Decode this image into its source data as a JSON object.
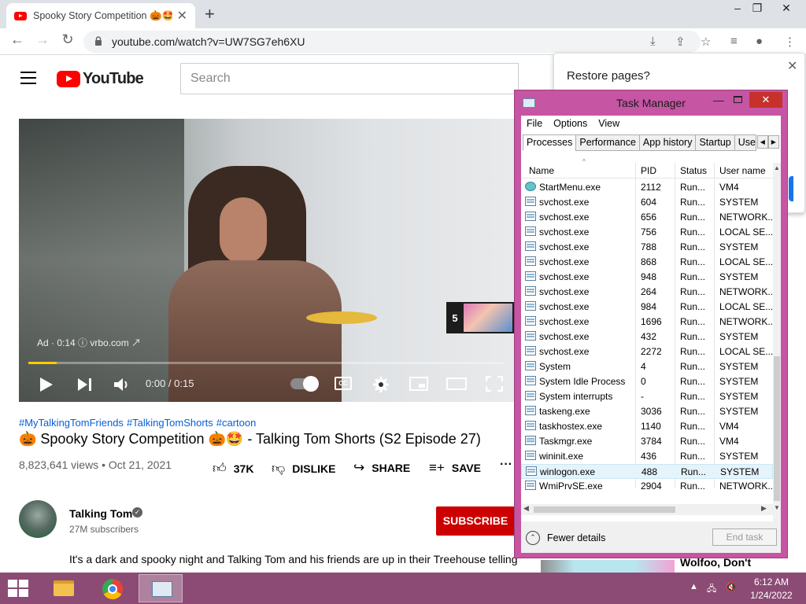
{
  "browser": {
    "tab_title": "Spooky Story Competition 🎃🤩",
    "url": "youtube.com/watch?v=UW7SG7eh6XU"
  },
  "youtube": {
    "logo_text": "YouTube",
    "search_placeholder": "Search",
    "player": {
      "ad_label": "Ad · 0:14 ⓘ  vrbo.com ↗",
      "next_ad_count": "5",
      "time": "0:00 / 0:15",
      "progress_fraction": 0.06,
      "cc_label": "CC"
    },
    "hashtags": [
      "#MyTalkingTomFriends",
      "#TalkingTomShorts",
      "#cartoon"
    ],
    "title": "🎃 Spooky Story Competition 🎃🤩 - Talking Tom Shorts (S2 Episode 27)",
    "views": "8,823,641 views • Oct 21, 2021",
    "actions": {
      "like": "37K",
      "dislike": "DISLIKE",
      "share": "SHARE",
      "save": "SAVE"
    },
    "channel": {
      "name": "Talking Tom",
      "subscribers": "27M subscribers",
      "subscribe_label": "SUBSCRIBE"
    },
    "description": "It's a dark and spooky night and Talking Tom and his friends are up in their Treehouse telling scary stories by torchlight... But who's going to tell the SCARIEST story?! And when poison...",
    "recommended_title": "Wolfoo, Don't"
  },
  "restore_popup": {
    "title": "Restore pages?"
  },
  "task_manager": {
    "title": "Task Manager",
    "menu": [
      "File",
      "Options",
      "View"
    ],
    "tabs": [
      "Processes",
      "Performance",
      "App history",
      "Startup",
      "User"
    ],
    "columns": {
      "name": "Name",
      "pid": "PID",
      "status": "Status",
      "user": "User name"
    },
    "rows": [
      {
        "name": "StartMenu.exe",
        "pid": "2112",
        "status": "Run...",
        "user": "VM4",
        "icon": "startmenu-icon"
      },
      {
        "name": "svchost.exe",
        "pid": "604",
        "status": "Run...",
        "user": "SYSTEM",
        "icon": "process-icon"
      },
      {
        "name": "svchost.exe",
        "pid": "656",
        "status": "Run...",
        "user": "NETWORK...",
        "icon": "process-icon"
      },
      {
        "name": "svchost.exe",
        "pid": "756",
        "status": "Run...",
        "user": "LOCAL SE...",
        "icon": "process-icon"
      },
      {
        "name": "svchost.exe",
        "pid": "788",
        "status": "Run...",
        "user": "SYSTEM",
        "icon": "process-icon"
      },
      {
        "name": "svchost.exe",
        "pid": "868",
        "status": "Run...",
        "user": "LOCAL SE...",
        "icon": "process-icon"
      },
      {
        "name": "svchost.exe",
        "pid": "948",
        "status": "Run...",
        "user": "SYSTEM",
        "icon": "process-icon"
      },
      {
        "name": "svchost.exe",
        "pid": "264",
        "status": "Run...",
        "user": "NETWORK...",
        "icon": "process-icon"
      },
      {
        "name": "svchost.exe",
        "pid": "984",
        "status": "Run...",
        "user": "LOCAL SE...",
        "icon": "process-icon"
      },
      {
        "name": "svchost.exe",
        "pid": "1696",
        "status": "Run...",
        "user": "NETWORK...",
        "icon": "process-icon"
      },
      {
        "name": "svchost.exe",
        "pid": "432",
        "status": "Run...",
        "user": "SYSTEM",
        "icon": "process-icon"
      },
      {
        "name": "svchost.exe",
        "pid": "2272",
        "status": "Run...",
        "user": "LOCAL SE...",
        "icon": "process-icon"
      },
      {
        "name": "System",
        "pid": "4",
        "status": "Run...",
        "user": "SYSTEM",
        "icon": "process-icon"
      },
      {
        "name": "System Idle Process",
        "pid": "0",
        "status": "Run...",
        "user": "SYSTEM",
        "icon": "process-icon"
      },
      {
        "name": "System interrupts",
        "pid": "-",
        "status": "Run...",
        "user": "SYSTEM",
        "icon": "process-icon"
      },
      {
        "name": "taskeng.exe",
        "pid": "3036",
        "status": "Run...",
        "user": "SYSTEM",
        "icon": "process-icon"
      },
      {
        "name": "taskhostex.exe",
        "pid": "1140",
        "status": "Run...",
        "user": "VM4",
        "icon": "process-icon"
      },
      {
        "name": "Taskmgr.exe",
        "pid": "3784",
        "status": "Run...",
        "user": "VM4",
        "icon": "taskmgr-icon"
      },
      {
        "name": "wininit.exe",
        "pid": "436",
        "status": "Run...",
        "user": "SYSTEM",
        "icon": "process-icon"
      },
      {
        "name": "winlogon.exe",
        "pid": "488",
        "status": "Run...",
        "user": "SYSTEM",
        "icon": "process-icon",
        "selected": true
      },
      {
        "name": "WmiPrvSE.exe",
        "pid": "2904",
        "status": "Run...",
        "user": "NETWORK...",
        "icon": "process-icon"
      }
    ],
    "fewer_details": "Fewer details",
    "end_task": "End task"
  },
  "taskbar": {
    "time": "6:12 AM",
    "date": "1/24/2022"
  },
  "colors": {
    "task_manager_frame": "#c655a3",
    "taskbar": "#8c4b75",
    "subscribe_button": "#cc0000",
    "youtube_red": "#ff0000",
    "close_button": "#c7312c",
    "progress_fill": "#ffcc00"
  }
}
